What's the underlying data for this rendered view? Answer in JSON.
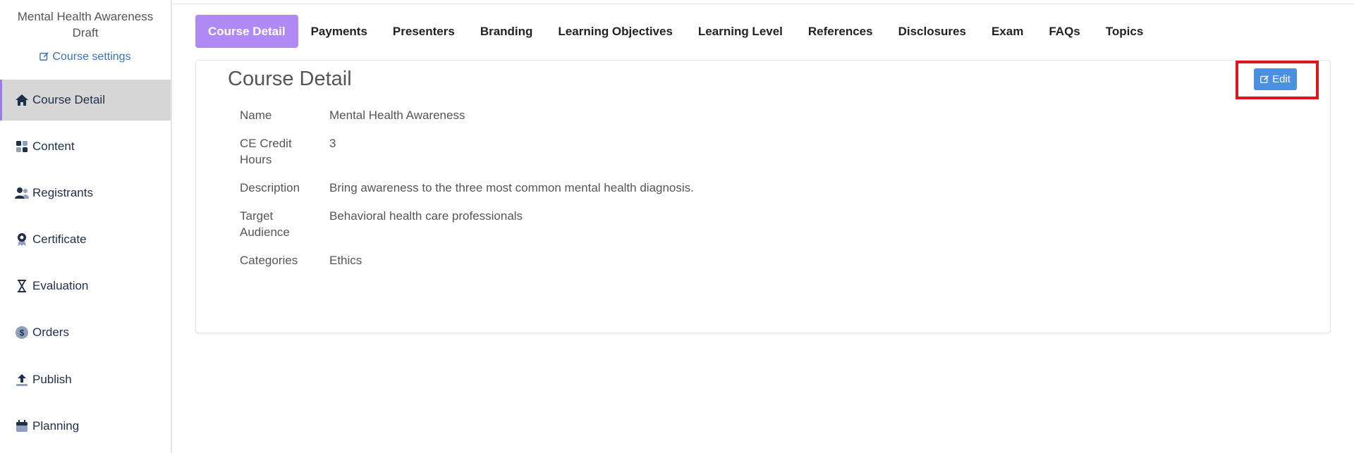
{
  "sidebar": {
    "course_title_line1": "Mental Health Awareness",
    "course_title_line2": "Draft",
    "settings_label": "Course settings",
    "items": [
      {
        "label": "Course Detail",
        "icon": "home-icon",
        "active": true
      },
      {
        "label": "Content",
        "icon": "grid-icon"
      },
      {
        "label": "Registrants",
        "icon": "users-icon"
      },
      {
        "label": "Certificate",
        "icon": "award-icon"
      },
      {
        "label": "Evaluation",
        "icon": "hourglass-icon"
      },
      {
        "label": "Orders",
        "icon": "dollar-icon"
      },
      {
        "label": "Publish",
        "icon": "upload-icon"
      },
      {
        "label": "Planning",
        "icon": "calendar-icon"
      }
    ]
  },
  "tabs": [
    {
      "label": "Course Detail",
      "active": true
    },
    {
      "label": "Payments"
    },
    {
      "label": "Presenters"
    },
    {
      "label": "Branding"
    },
    {
      "label": "Learning Objectives"
    },
    {
      "label": "Learning Level"
    },
    {
      "label": "References"
    },
    {
      "label": "Disclosures"
    },
    {
      "label": "Exam"
    },
    {
      "label": "FAQs"
    },
    {
      "label": "Topics"
    }
  ],
  "detail": {
    "title": "Course Detail",
    "edit_label": "Edit",
    "rows": [
      {
        "label": "Name",
        "value": "Mental Health Awareness"
      },
      {
        "label": "CE Credit Hours",
        "value": "3"
      },
      {
        "label": "Description",
        "value": "Bring awareness to the three most common mental health diagnosis."
      },
      {
        "label": "Target Audience",
        "value": "Behavioral health care professionals"
      },
      {
        "label": "Categories",
        "value": "Ethics"
      }
    ]
  },
  "colors": {
    "accent_tab": "#b089f5",
    "edit_button": "#4a90e2",
    "highlight": "#e0141b",
    "link": "#3a73b8"
  }
}
